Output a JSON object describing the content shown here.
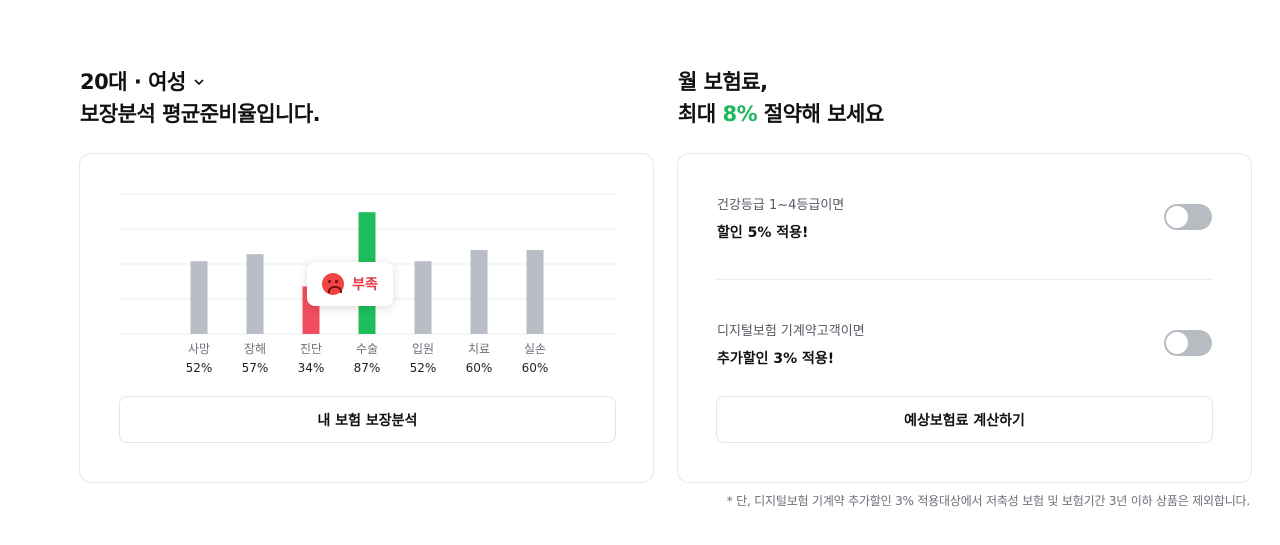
{
  "left": {
    "title_prefix": "20대 · 여성",
    "title_line2": "보장분석 평균준비율입니다.",
    "analyze_button": "내 보험 보장분석"
  },
  "right": {
    "title_line1": "월 보험료,",
    "title_line2_pre": "최대 ",
    "title_line2_accent": "8%",
    "title_line2_post": " 절약해 보세요",
    "options": [
      {
        "sub": "건강등급 1~4등급이면",
        "main": "할인 5% 적용!"
      },
      {
        "sub": "디지털보험 기계약고객이면",
        "main": "추가할인 3% 적용!"
      }
    ],
    "calc_button": "예상보험료 계산하기",
    "footnote": "* 단, 디지털보험 기계약 추가할인 3% 적용대상에서 저축성 보험 및 보험기간 3년 이하 상품은 제외합니다."
  },
  "tooltip": {
    "label": "부족"
  },
  "colors": {
    "accent": "#1fb85c",
    "bar_default": "#b9bec6",
    "bar_low": "#f04d5e",
    "bar_high": "#1fbe5c"
  },
  "chart_data": {
    "type": "bar",
    "categories": [
      "사망",
      "장해",
      "진단",
      "수술",
      "입원",
      "치료",
      "실손"
    ],
    "values": [
      52,
      57,
      34,
      87,
      52,
      60,
      60
    ],
    "value_labels": [
      "52%",
      "57%",
      "34%",
      "87%",
      "52%",
      "60%",
      "60%"
    ],
    "highlight": {
      "low_index": 2,
      "high_index": 3
    },
    "ylim": [
      0,
      100
    ],
    "grid": true
  }
}
